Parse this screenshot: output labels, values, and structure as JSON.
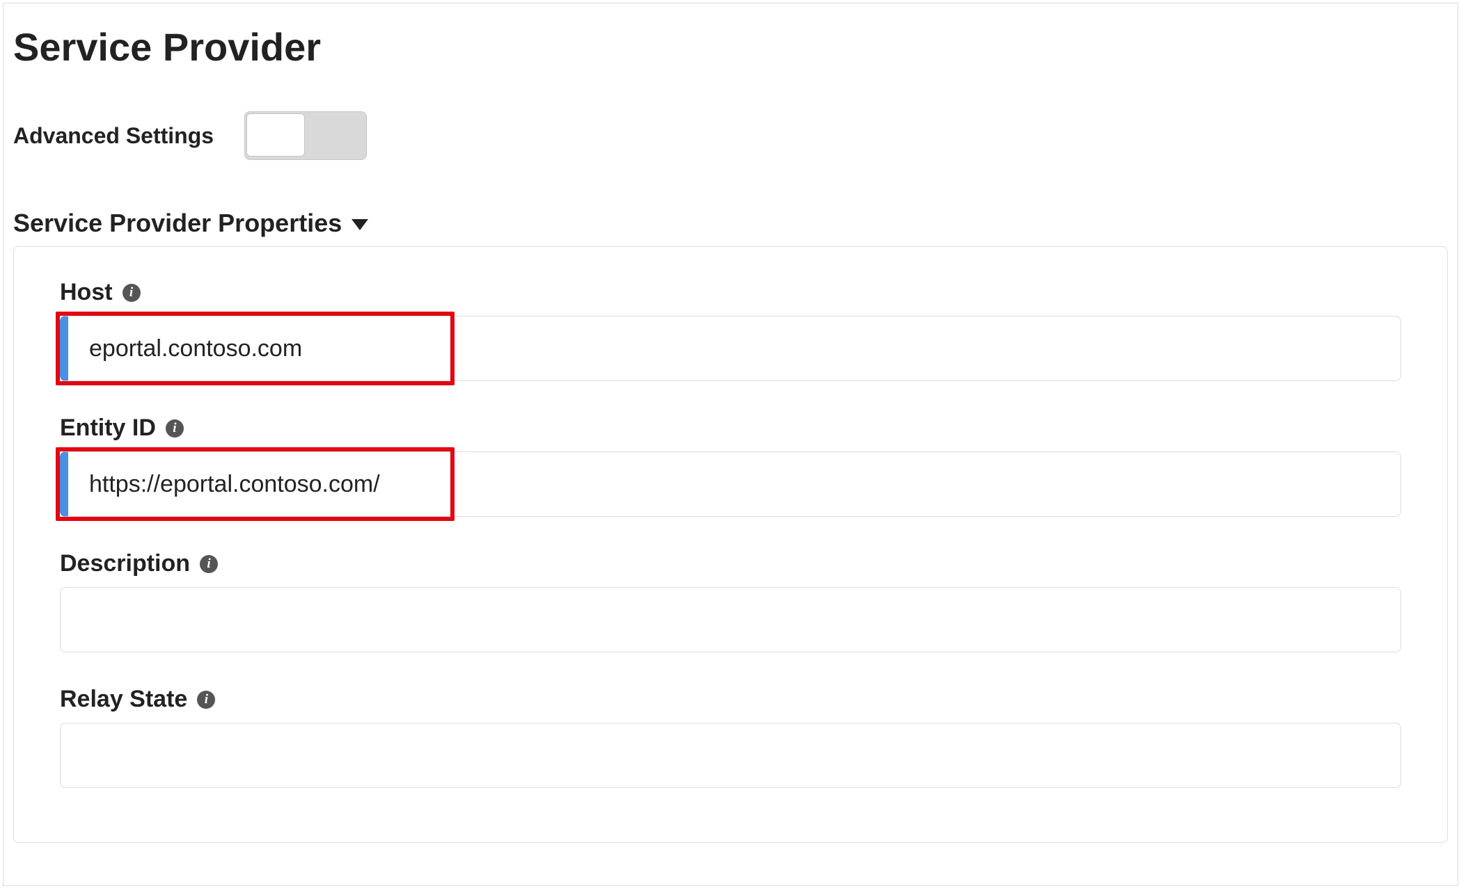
{
  "page": {
    "title": "Service Provider"
  },
  "advanced": {
    "label": "Advanced Settings",
    "enabled": false
  },
  "section": {
    "title": "Service Provider Properties"
  },
  "fields": {
    "host": {
      "label": "Host",
      "value": "eportal.contoso.com"
    },
    "entity_id": {
      "label": "Entity ID",
      "value": "https://eportal.contoso.com/"
    },
    "description": {
      "label": "Description",
      "value": ""
    },
    "relay_state": {
      "label": "Relay State",
      "value": ""
    }
  }
}
